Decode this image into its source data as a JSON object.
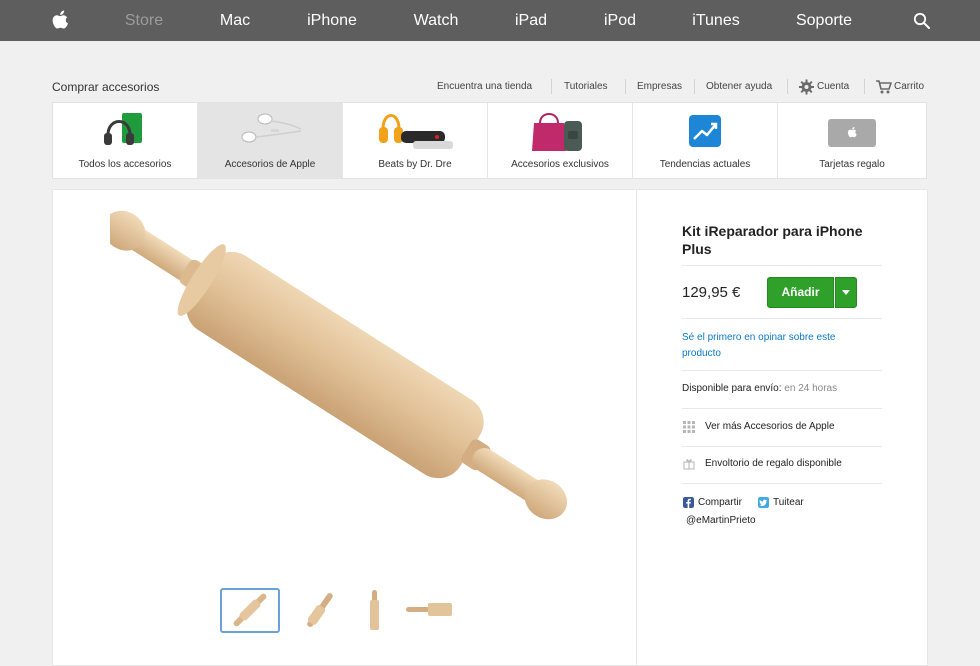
{
  "nav": {
    "items": [
      "Store",
      "Mac",
      "iPhone",
      "Watch",
      "iPad",
      "iPod",
      "iTunes",
      "Soporte"
    ],
    "active": "Store",
    "logo_icon": "apple-logo-icon",
    "search_icon": "search-icon"
  },
  "subheader": {
    "title": "Comprar accesorios",
    "links": [
      "Encuentra una tienda",
      "Tutoriales",
      "Empresas",
      "Obtener ayuda"
    ],
    "account": "Cuenta",
    "cart": "Carrito"
  },
  "categories": [
    {
      "label": "Todos los accesorios",
      "icon": "headphones-case-icon"
    },
    {
      "label": "Accesorios de Apple",
      "icon": "earpods-icon",
      "selected": true
    },
    {
      "label": "Beats by Dr. Dre",
      "icon": "beats-speaker-icon"
    },
    {
      "label": "Accesorios exclusivos",
      "icon": "bags-icon"
    },
    {
      "label": "Tendencias actuales",
      "icon": "trend-chart-icon"
    },
    {
      "label": "Tarjetas regalo",
      "icon": "gift-card-icon"
    }
  ],
  "product": {
    "title": "Kit iReparador para iPhone Plus",
    "price": "129,95 €",
    "add_button": "Añadir",
    "review_link": "Sé el primero en opinar sobre este producto",
    "availability_label": "Disponible para envío:",
    "availability_value": "en 24 horas",
    "more_link": "Ver más Accesorios de Apple",
    "gift_wrap": "Envoltorio de regalo disponible",
    "share_facebook": "Compartir",
    "share_twitter": "Tuitear",
    "handle": "@eMartinPrieto",
    "image_icon": "rolling-pin-image",
    "thumbnails": [
      "rolling-pin-diagonal",
      "rolling-pin-angled",
      "rolling-pin-vertical",
      "rolling-pin-horizontal"
    ]
  },
  "colors": {
    "nav_bg": "#5e5e5e",
    "page_bg": "#f0f0f0",
    "add_green": "#2fa12b",
    "link_blue": "#0b78c7",
    "wood": "#e2c39a"
  }
}
